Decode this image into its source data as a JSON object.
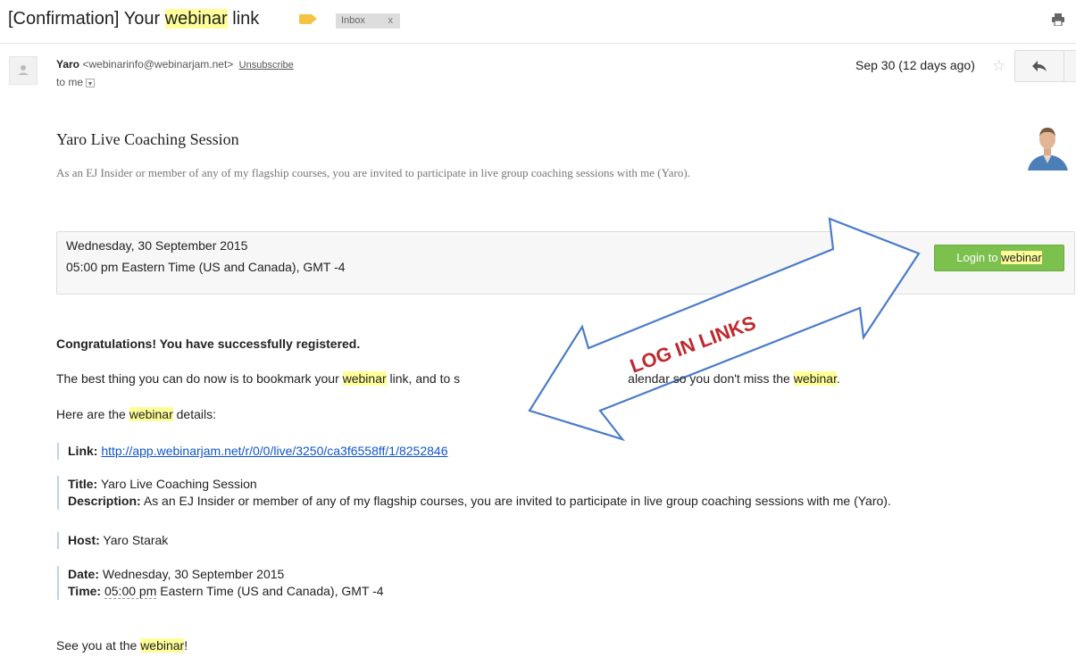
{
  "email": {
    "subject_prefix": "[Confirmation] Your ",
    "subject_highlight": "webinar",
    "subject_suffix": " link",
    "label_color": "#f5c342",
    "inbox_label": "Inbox",
    "inbox_close": "x",
    "print_icon": "print-icon",
    "sender": {
      "name": "Yaro",
      "email": "<webinarinfo@webinarjam.net>",
      "unsubscribe": "Unsubscribe",
      "to": "to me"
    },
    "date": "Sep 30 (12 days ago)",
    "star_icon": "star-icon",
    "reply_icon": "reply-icon"
  },
  "body": {
    "title": "Yaro Live Coaching Session",
    "intro": "As an EJ Insider or member of any of my flagship courses, you are invited to participate in live group coaching sessions with me (Yaro).",
    "event": {
      "date": "Wednesday, 30 September 2015",
      "time": "05:00 pm Eastern Time (US and Canada), GMT -4",
      "login_prefix": "Login to ",
      "login_highlight": "webinar",
      "button_color": "#7cc04e"
    },
    "annotation": {
      "text": "LOG IN LINKS",
      "arrow_color": "#4a7cc7",
      "text_color": "#c0292e"
    },
    "congrats": "Congratulations! You have successfully registered.",
    "bookmark": {
      "part1": "The best thing you can do now is to bookmark your ",
      "hl1": "webinar",
      "part2": " link, and to s",
      "part3": "alendar so you don't miss the ",
      "hl2": "webinar",
      "part4": "."
    },
    "details_intro": {
      "part1": "Here are the ",
      "hl": "webinar",
      "part2": " details:"
    },
    "details": {
      "link_label": "Link:",
      "link_url": "http://app.webinarjam.net/r/0/0/live/3250/ca3f6558ff/1/8252846",
      "title_label": "Title:",
      "title_value": "Yaro Live Coaching Session",
      "description_label": "Description:",
      "description_value": "As an EJ Insider or member of any of my flagship courses, you are invited to participate in live group coaching sessions with me (Yaro).",
      "host_label": "Host:",
      "host_value": "Yaro Starak",
      "date_label": "Date:",
      "date_value": "Wednesday, 30 September 2015",
      "time_label": "Time:",
      "time_value": "05:00 pm",
      "time_suffix": " Eastern Time (US and Canada), GMT -4"
    },
    "signoff": {
      "part1": "See you at the ",
      "hl": "webinar",
      "part2": "!"
    }
  }
}
